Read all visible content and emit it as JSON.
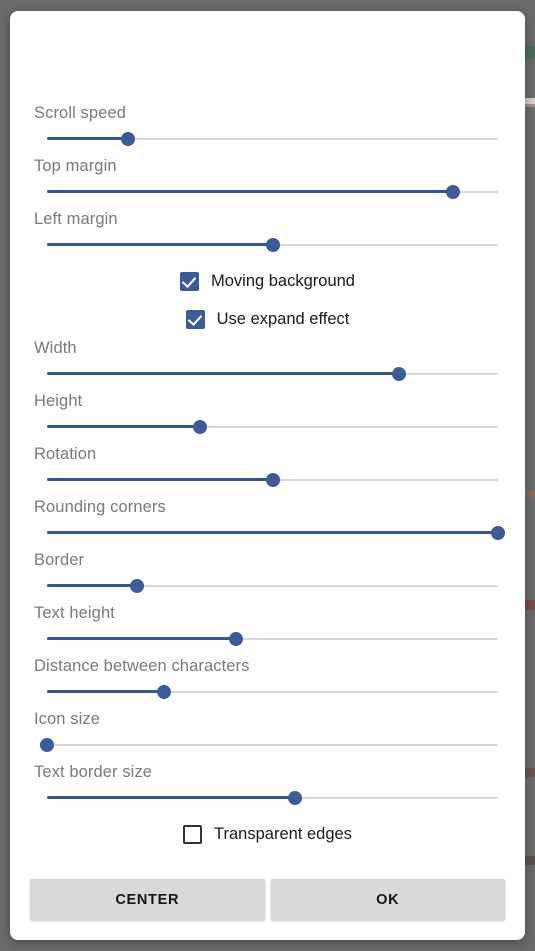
{
  "dialog": {
    "sliders": [
      {
        "label": "Scroll speed",
        "value": 18
      },
      {
        "label": "Top margin",
        "value": 90
      },
      {
        "label": "Left margin",
        "value": 50
      },
      {
        "label": "Width",
        "value": 78
      },
      {
        "label": "Height",
        "value": 34
      },
      {
        "label": "Rotation",
        "value": 50
      },
      {
        "label": "Rounding corners",
        "value": 100
      },
      {
        "label": "Border",
        "value": 20
      },
      {
        "label": "Text height",
        "value": 42
      },
      {
        "label": "Distance between characters",
        "value": 26
      },
      {
        "label": "Icon size",
        "value": 0
      },
      {
        "label": "Text border size",
        "value": 55
      }
    ],
    "checkboxes": [
      {
        "label": "Moving background",
        "checked": true
      },
      {
        "label": "Use expand effect",
        "checked": true
      },
      {
        "label": "Transparent edges",
        "checked": false
      }
    ],
    "buttons": {
      "center_label": "CENTER",
      "ok_label": "OK"
    },
    "colors": {
      "accent": "#3c5c99",
      "track": "#d8d8d8",
      "label": "#7a7a7a",
      "button_bg": "#d9d9d9",
      "backdrop": "#6b6b6b"
    }
  }
}
